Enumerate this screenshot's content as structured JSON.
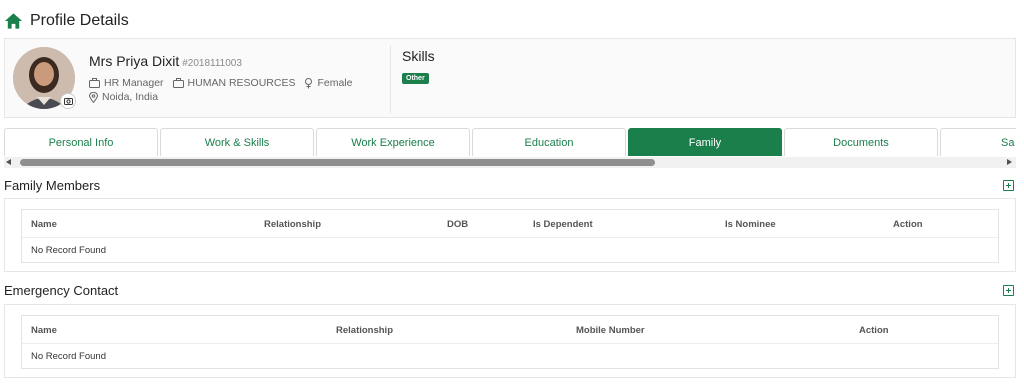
{
  "page": {
    "title": "Profile Details"
  },
  "profile": {
    "name": "Mrs Priya Dixit",
    "employee_id": "#2018111003",
    "designation": "HR Manager",
    "department": "HUMAN RESOURCES",
    "gender": "Female",
    "location": "Noida, India"
  },
  "skills": {
    "title": "Skills",
    "badge": "Other"
  },
  "tabs": [
    {
      "label": "Personal Info"
    },
    {
      "label": "Work & Skills"
    },
    {
      "label": "Work Experience"
    },
    {
      "label": "Education"
    },
    {
      "label": "Family",
      "active": true
    },
    {
      "label": "Documents"
    },
    {
      "label": "Sa"
    }
  ],
  "family_members": {
    "title": "Family Members",
    "columns": [
      "Name",
      "Relationship",
      "DOB",
      "Is Dependent",
      "Is Nominee",
      "Action"
    ],
    "empty_text": "No Record Found"
  },
  "emergency_contact": {
    "title": "Emergency Contact",
    "columns": [
      "Name",
      "Relationship",
      "Mobile Number",
      "Action"
    ],
    "empty_text": "No Record Found"
  },
  "colors": {
    "accent": "#1a7f4b",
    "border": "#e6e6e6"
  }
}
